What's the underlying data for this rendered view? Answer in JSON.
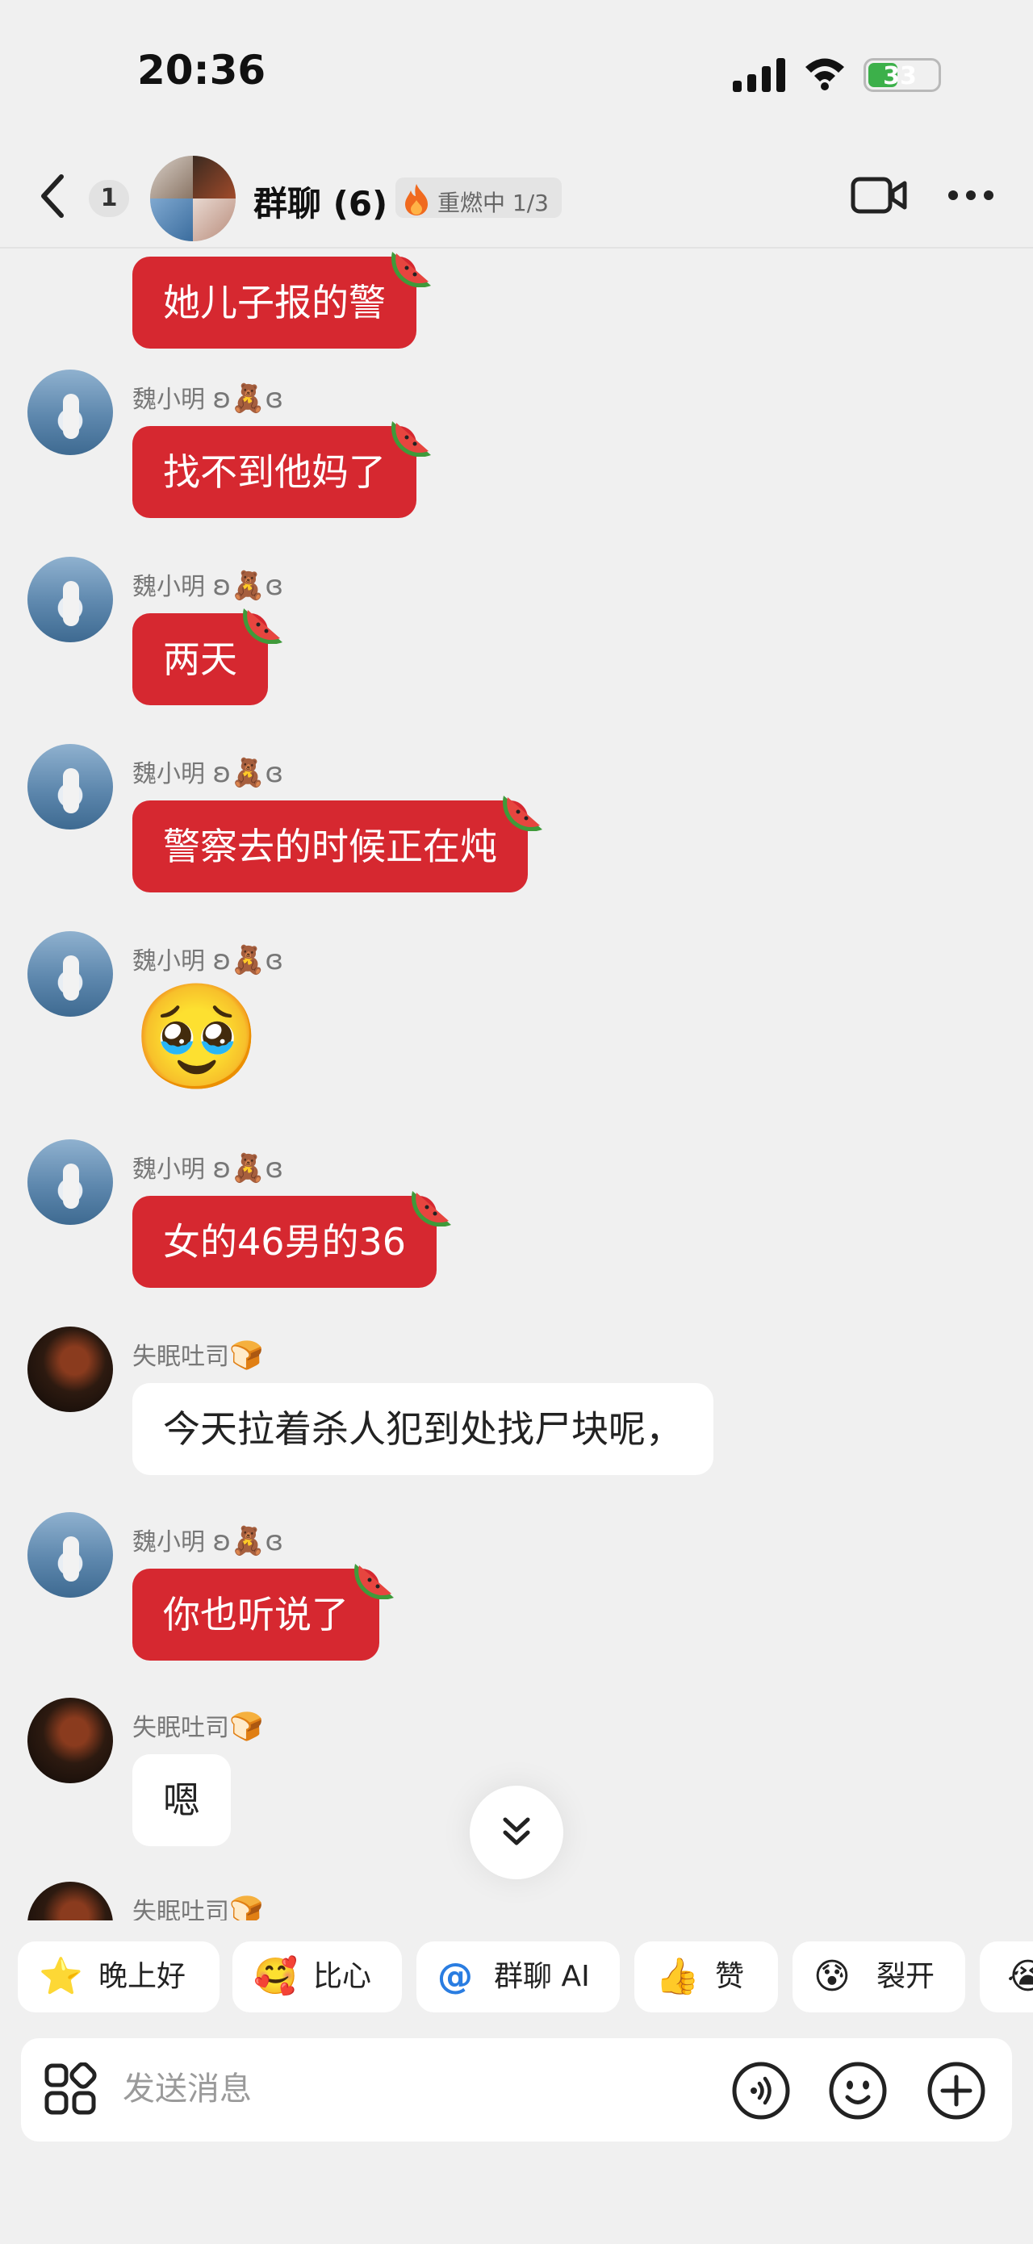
{
  "status_bar": {
    "time": "20:36",
    "battery": "33"
  },
  "header": {
    "unread_count": "1",
    "title": "群聊 (6)",
    "streak": "重燃中 1/3"
  },
  "messages": [
    {
      "sender": "",
      "badge": "",
      "text": "她儿子报的警",
      "style": "red",
      "melon": true
    },
    {
      "sender": "魏小明",
      "badge": "ʚ🧸ɞ",
      "text": "找不到他妈了",
      "style": "red",
      "melon": true
    },
    {
      "sender": "魏小明",
      "badge": "ʚ🧸ɞ",
      "text": "两天",
      "style": "red",
      "melon": true
    },
    {
      "sender": "魏小明",
      "badge": "ʚ🧸ɞ",
      "text": "警察去的时候正在炖",
      "style": "red",
      "melon": true
    },
    {
      "sender": "魏小明",
      "badge": "ʚ🧸ɞ",
      "emoji": "🥹"
    },
    {
      "sender": "魏小明",
      "badge": "ʚ🧸ɞ",
      "text": "女的46男的36",
      "style": "red",
      "melon": true
    },
    {
      "sender": "失眠吐司",
      "badge": "🍞",
      "text": "今天拉着杀人犯到处找尸块呢，",
      "style": "white"
    },
    {
      "sender": "魏小明",
      "badge": "ʚ🧸ɞ",
      "text": "你也听说了",
      "style": "red",
      "melon": true
    },
    {
      "sender": "失眠吐司",
      "badge": "🍞",
      "text": "嗯",
      "style": "white"
    },
    {
      "sender": "失眠吐司",
      "badge": "🍞"
    }
  ],
  "quick_replies": [
    {
      "icon": "⭐",
      "label": "晚上好"
    },
    {
      "icon": "🥰",
      "label": "比心"
    },
    {
      "icon": "@",
      "label": "群聊 AI"
    },
    {
      "icon": "👍",
      "label": "赞"
    },
    {
      "icon": "😰",
      "label": "裂开"
    }
  ],
  "input": {
    "placeholder": "发送消息"
  },
  "colors": {
    "bubble_red": "#d62830",
    "background": "#f0f0f0",
    "battery_green": "#3cb04a"
  }
}
